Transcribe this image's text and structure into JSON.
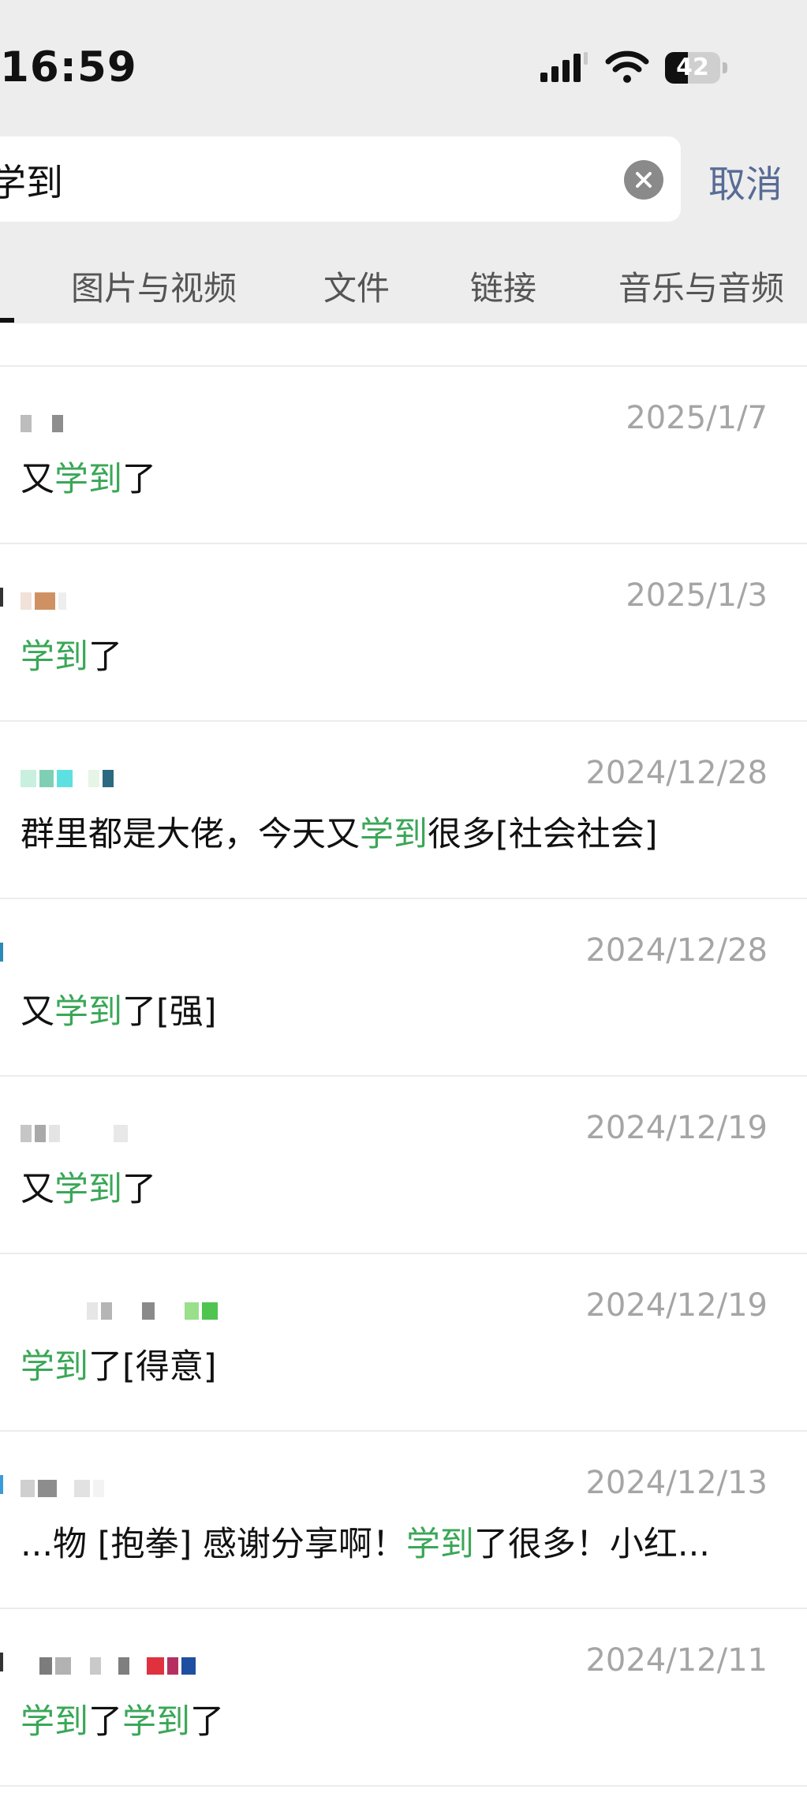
{
  "status_bar": {
    "time": "16:59",
    "battery_level": "42",
    "battery_fraction": 0.42,
    "icons": [
      "signal-icon",
      "wifi-icon",
      "battery-icon"
    ]
  },
  "search": {
    "query": "学到",
    "clear_icon": "clear-icon",
    "cancel_label": "取消"
  },
  "tabs": [
    {
      "label": "图片与视频"
    },
    {
      "label": "文件"
    },
    {
      "label": "链接"
    },
    {
      "label": "音乐与音频"
    }
  ],
  "highlight_color": "#3aa757",
  "results": [
    {
      "date": "2025/1/7",
      "text": [
        {
          "t": "又",
          "h": false
        },
        {
          "t": "学到",
          "h": true
        },
        {
          "t": "了",
          "h": false
        }
      ]
    },
    {
      "date": "2025/1/3",
      "text": [
        {
          "t": "学到",
          "h": true
        },
        {
          "t": "了",
          "h": false
        }
      ]
    },
    {
      "date": "2024/12/28",
      "text": [
        {
          "t": "群里都是大佬，今天又",
          "h": false
        },
        {
          "t": "学到",
          "h": true
        },
        {
          "t": "很多[社会社会]",
          "h": false
        }
      ]
    },
    {
      "date": "2024/12/28",
      "text": [
        {
          "t": "又",
          "h": false
        },
        {
          "t": "学到",
          "h": true
        },
        {
          "t": "了[强]",
          "h": false
        }
      ]
    },
    {
      "date": "2024/12/19",
      "text": [
        {
          "t": "又",
          "h": false
        },
        {
          "t": "学到",
          "h": true
        },
        {
          "t": "了",
          "h": false
        }
      ]
    },
    {
      "date": "2024/12/19",
      "text": [
        {
          "t": "学到",
          "h": true
        },
        {
          "t": "了[得意]",
          "h": false
        }
      ]
    },
    {
      "date": "2024/12/13",
      "text": [
        {
          "t": "...物 [抱拳] 感谢分享啊！",
          "h": false
        },
        {
          "t": "学到",
          "h": true
        },
        {
          "t": "了很多！小红...",
          "h": false
        }
      ]
    },
    {
      "date": "2024/12/11",
      "text": [
        {
          "t": "学到",
          "h": true
        },
        {
          "t": "了",
          "h": false
        },
        {
          "t": "学到",
          "h": true
        },
        {
          "t": "了",
          "h": false
        }
      ]
    }
  ]
}
